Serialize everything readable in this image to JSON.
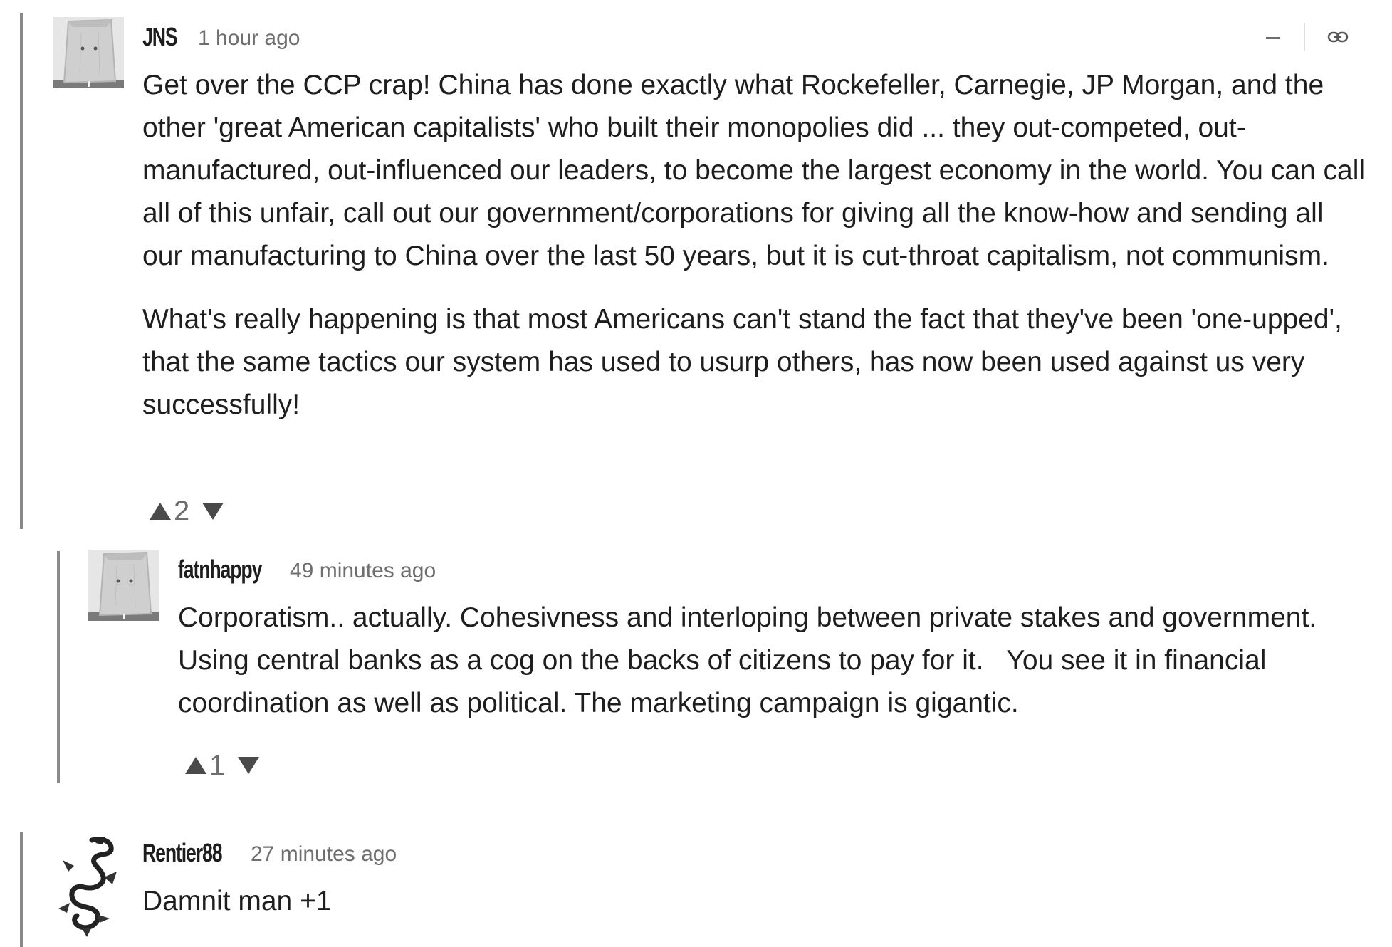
{
  "comments": [
    {
      "author": "JNS",
      "timestamp": "1 hour ago",
      "paragraphs": [
        "Get over the CCP crap! China has done exactly what Rockefeller, Carnegie, JP Morgan, and the other 'great American capitalists' who built their monopolies did ... they out-competed, out-manufactured, out-influenced our leaders, to become the largest economy in the world. You can call all of this unfair, call out our government/corporations for giving all the know-how and sending all our manufacturing to China over the last 50 years, but it is cut-throat capitalism, not communism.",
        "What's really happening is that most Americans can't stand the fact that they've been 'one-upped', that the same tactics our system has used to usurp others, has now been used against us very successfully!"
      ],
      "votes": "2",
      "avatar_icon": "paper-bag-head-avatar"
    },
    {
      "author": "fatnhappy",
      "timestamp": "49 minutes ago",
      "paragraphs": [
        "Corporatism.. actually. Cohesivness and interloping between private stakes and government. Using central banks as a cog on the backs of citizens to pay for it.   You see it in financial coordination as well as political. The marketing campaign is gigantic."
      ],
      "votes": "1",
      "avatar_icon": "paper-bag-head-avatar"
    },
    {
      "author": "Rentier88",
      "timestamp": "27 minutes ago",
      "paragraphs": [
        "Damnit man +1"
      ],
      "avatar_icon": "dragon-avatar"
    }
  ],
  "controls": {
    "collapse_icon": "minus-icon",
    "link_icon": "chain-link-icon"
  },
  "colors": {
    "thread_border": "#8a8a8a",
    "text": "#1e1e1e",
    "meta": "#6e6e6e",
    "vote_arrow": "#4a4a4a"
  }
}
